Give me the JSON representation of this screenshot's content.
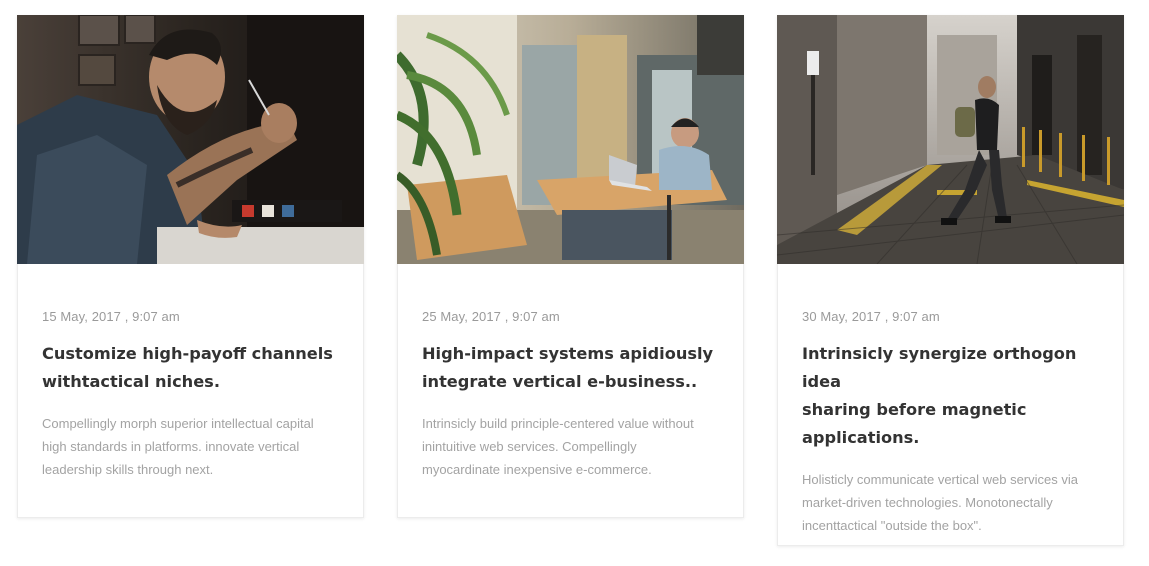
{
  "posts": [
    {
      "date": "15 May, 2017 , 9:07 am",
      "title_line1": "Customize high-payoff channels",
      "title_line2": "withtactical niches.",
      "excerpt_line1": "Compellingly morph superior intellectual capital",
      "excerpt_line2": "high standards in platforms. innovate vertical",
      "excerpt_line3": "leadership skills through next.",
      "image": "tattooed-man-drawing-photo"
    },
    {
      "date": "25 May, 2017 , 9:07 am",
      "title_line1": "High-impact systems apidiously",
      "title_line2": "integrate vertical e-business..",
      "excerpt_line1": "Intrinsicly build principle-centered value without",
      "excerpt_line2": "inintuitive web services. Compellingly",
      "excerpt_line3": "myocardinate inexpensive e-commerce.",
      "image": "office-laptop-photo"
    },
    {
      "date": "30 May, 2017 , 9:07 am",
      "title_line1": "Intrinsicly synergize orthogon idea",
      "title_line2": "sharing before magnetic",
      "title_line3": "applications.",
      "excerpt_line1": "Holisticly communicate vertical web services via",
      "excerpt_line2": "market-driven technologies. Monotonectally",
      "excerpt_line3": "incenttactical \"outside the box\".",
      "image": "man-walking-alley-photo"
    }
  ],
  "colors": {
    "title": "#333333",
    "date": "#9a9a9a",
    "excerpt": "#a3a3a3",
    "border": "#ececec"
  }
}
